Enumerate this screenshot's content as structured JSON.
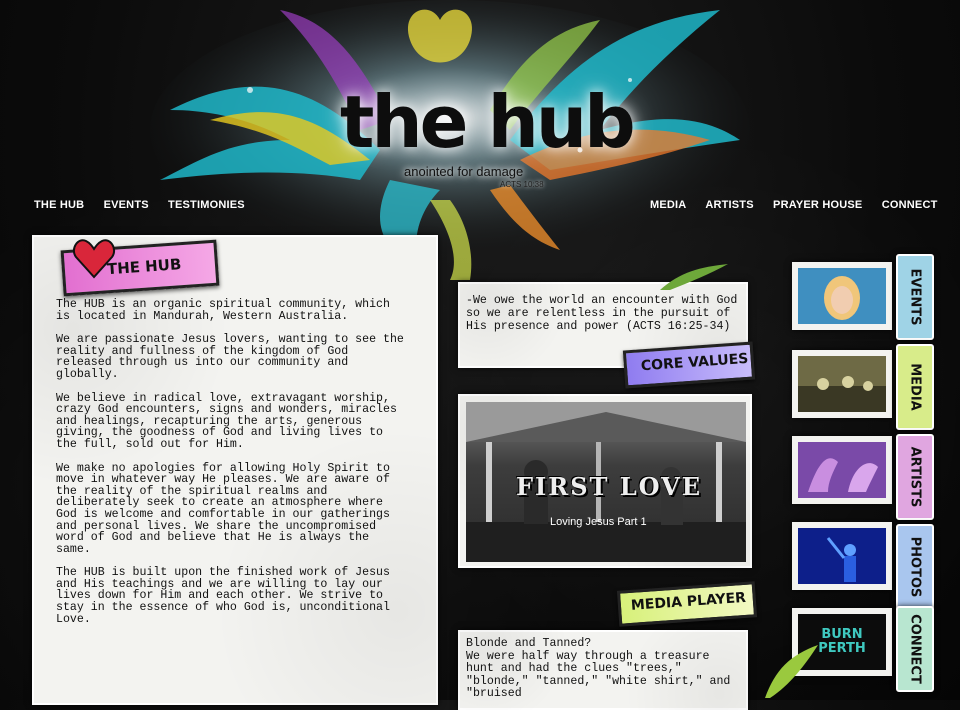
{
  "header": {
    "logo_title": "the hub",
    "tagline": "anointed for damage",
    "verse": "ACTS 10:38"
  },
  "nav": {
    "left": [
      "THE HUB",
      "EVENTS",
      "TESTIMONIES"
    ],
    "right": [
      "MEDIA",
      "ARTISTS",
      "PRAYER HOUSE",
      "CONNECT"
    ]
  },
  "about": {
    "label": "THE HUB",
    "paragraphs": [
      "The HUB is an organic spiritual community, which is located in Mandurah, Western Australia.",
      "We are passionate Jesus lovers, wanting to see the reality and fullness of the kingdom of God released through us into our community and globally.",
      "We believe in radical love, extravagant worship, crazy God encounters, signs and wonders, miracles and healings, recapturing the arts, generous giving, the goodness of God and living lives to the full, sold out for Him.",
      "We make no apologies for allowing Holy Spirit to move in whatever way He pleases. We are aware of the reality of the spiritual realms and deliberately seek to create an atmosphere where God is welcome and comfortable in our gatherings and personal lives. We share the uncompromised word of God and believe that He is always the same.",
      "The HUB is built upon the finished work of Jesus and His teachings and we are willing to lay our lives down for Him and each other. We strive to stay in the essence of who God is, unconditional Love."
    ]
  },
  "core_values": {
    "quote": "-We owe the world an encounter with God so we are relentless in the pursuit of His presence and power (ACTS 16:25-34)",
    "label": "CORE VALUES"
  },
  "media_player": {
    "video_title": "FIRST LOVE",
    "video_subtitle": "Loving Jesus Part 1",
    "label": "MEDIA PLAYER"
  },
  "testimony": {
    "title": "Blonde and Tanned?",
    "body": "We were half way through a treasure hunt and had the clues \"trees,\" \"blonde,\" \"tanned,\" \"white shirt,\" and \"bruised"
  },
  "rail": {
    "tabs": [
      "EVENTS",
      "MEDIA",
      "ARTISTS",
      "PHOTOS",
      "CONNECT"
    ],
    "tab_colors": [
      "#9fd3e6",
      "#d8ec8a",
      "#e0a6e0",
      "#a9c6ee",
      "#b8e6d0"
    ],
    "connect_thumb_text": "BURN PERTH"
  },
  "colors": {
    "background": "#0b0b0b",
    "paper": "#f3f3f0",
    "hub_label": "#e26fd0",
    "core_label": "#8f7cf0",
    "media_label": "#d7f07a"
  }
}
